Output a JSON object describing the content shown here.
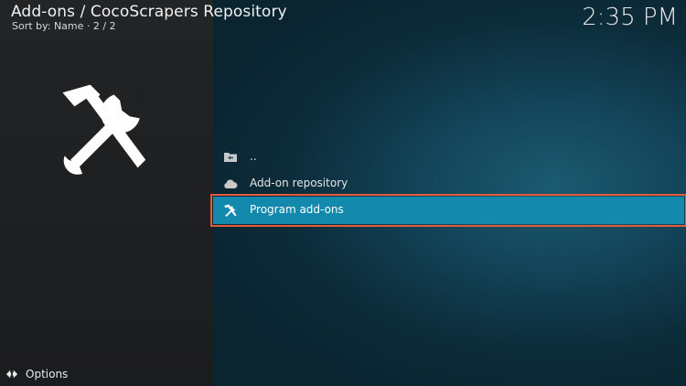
{
  "header": {
    "title": "Add-ons / CocoScrapers Repository",
    "sort_info": "Sort by: Name  · 2 / 2"
  },
  "clock": "2:35 PM",
  "hero_icon": "tools-icon",
  "list": {
    "items": [
      {
        "label": "..",
        "icon": "folder-back-icon",
        "selected": false
      },
      {
        "label": "Add-on repository",
        "icon": "cloud-icon",
        "selected": false
      },
      {
        "label": "Program add-ons",
        "icon": "tools-icon",
        "selected": true
      }
    ]
  },
  "footer": {
    "options_label": "Options",
    "options_icon": "options-arrows-icon"
  },
  "colors": {
    "selection": "#1289ad",
    "highlight_outline": "#e15b3c",
    "background_right": "#134459",
    "background_left": "#222426"
  }
}
